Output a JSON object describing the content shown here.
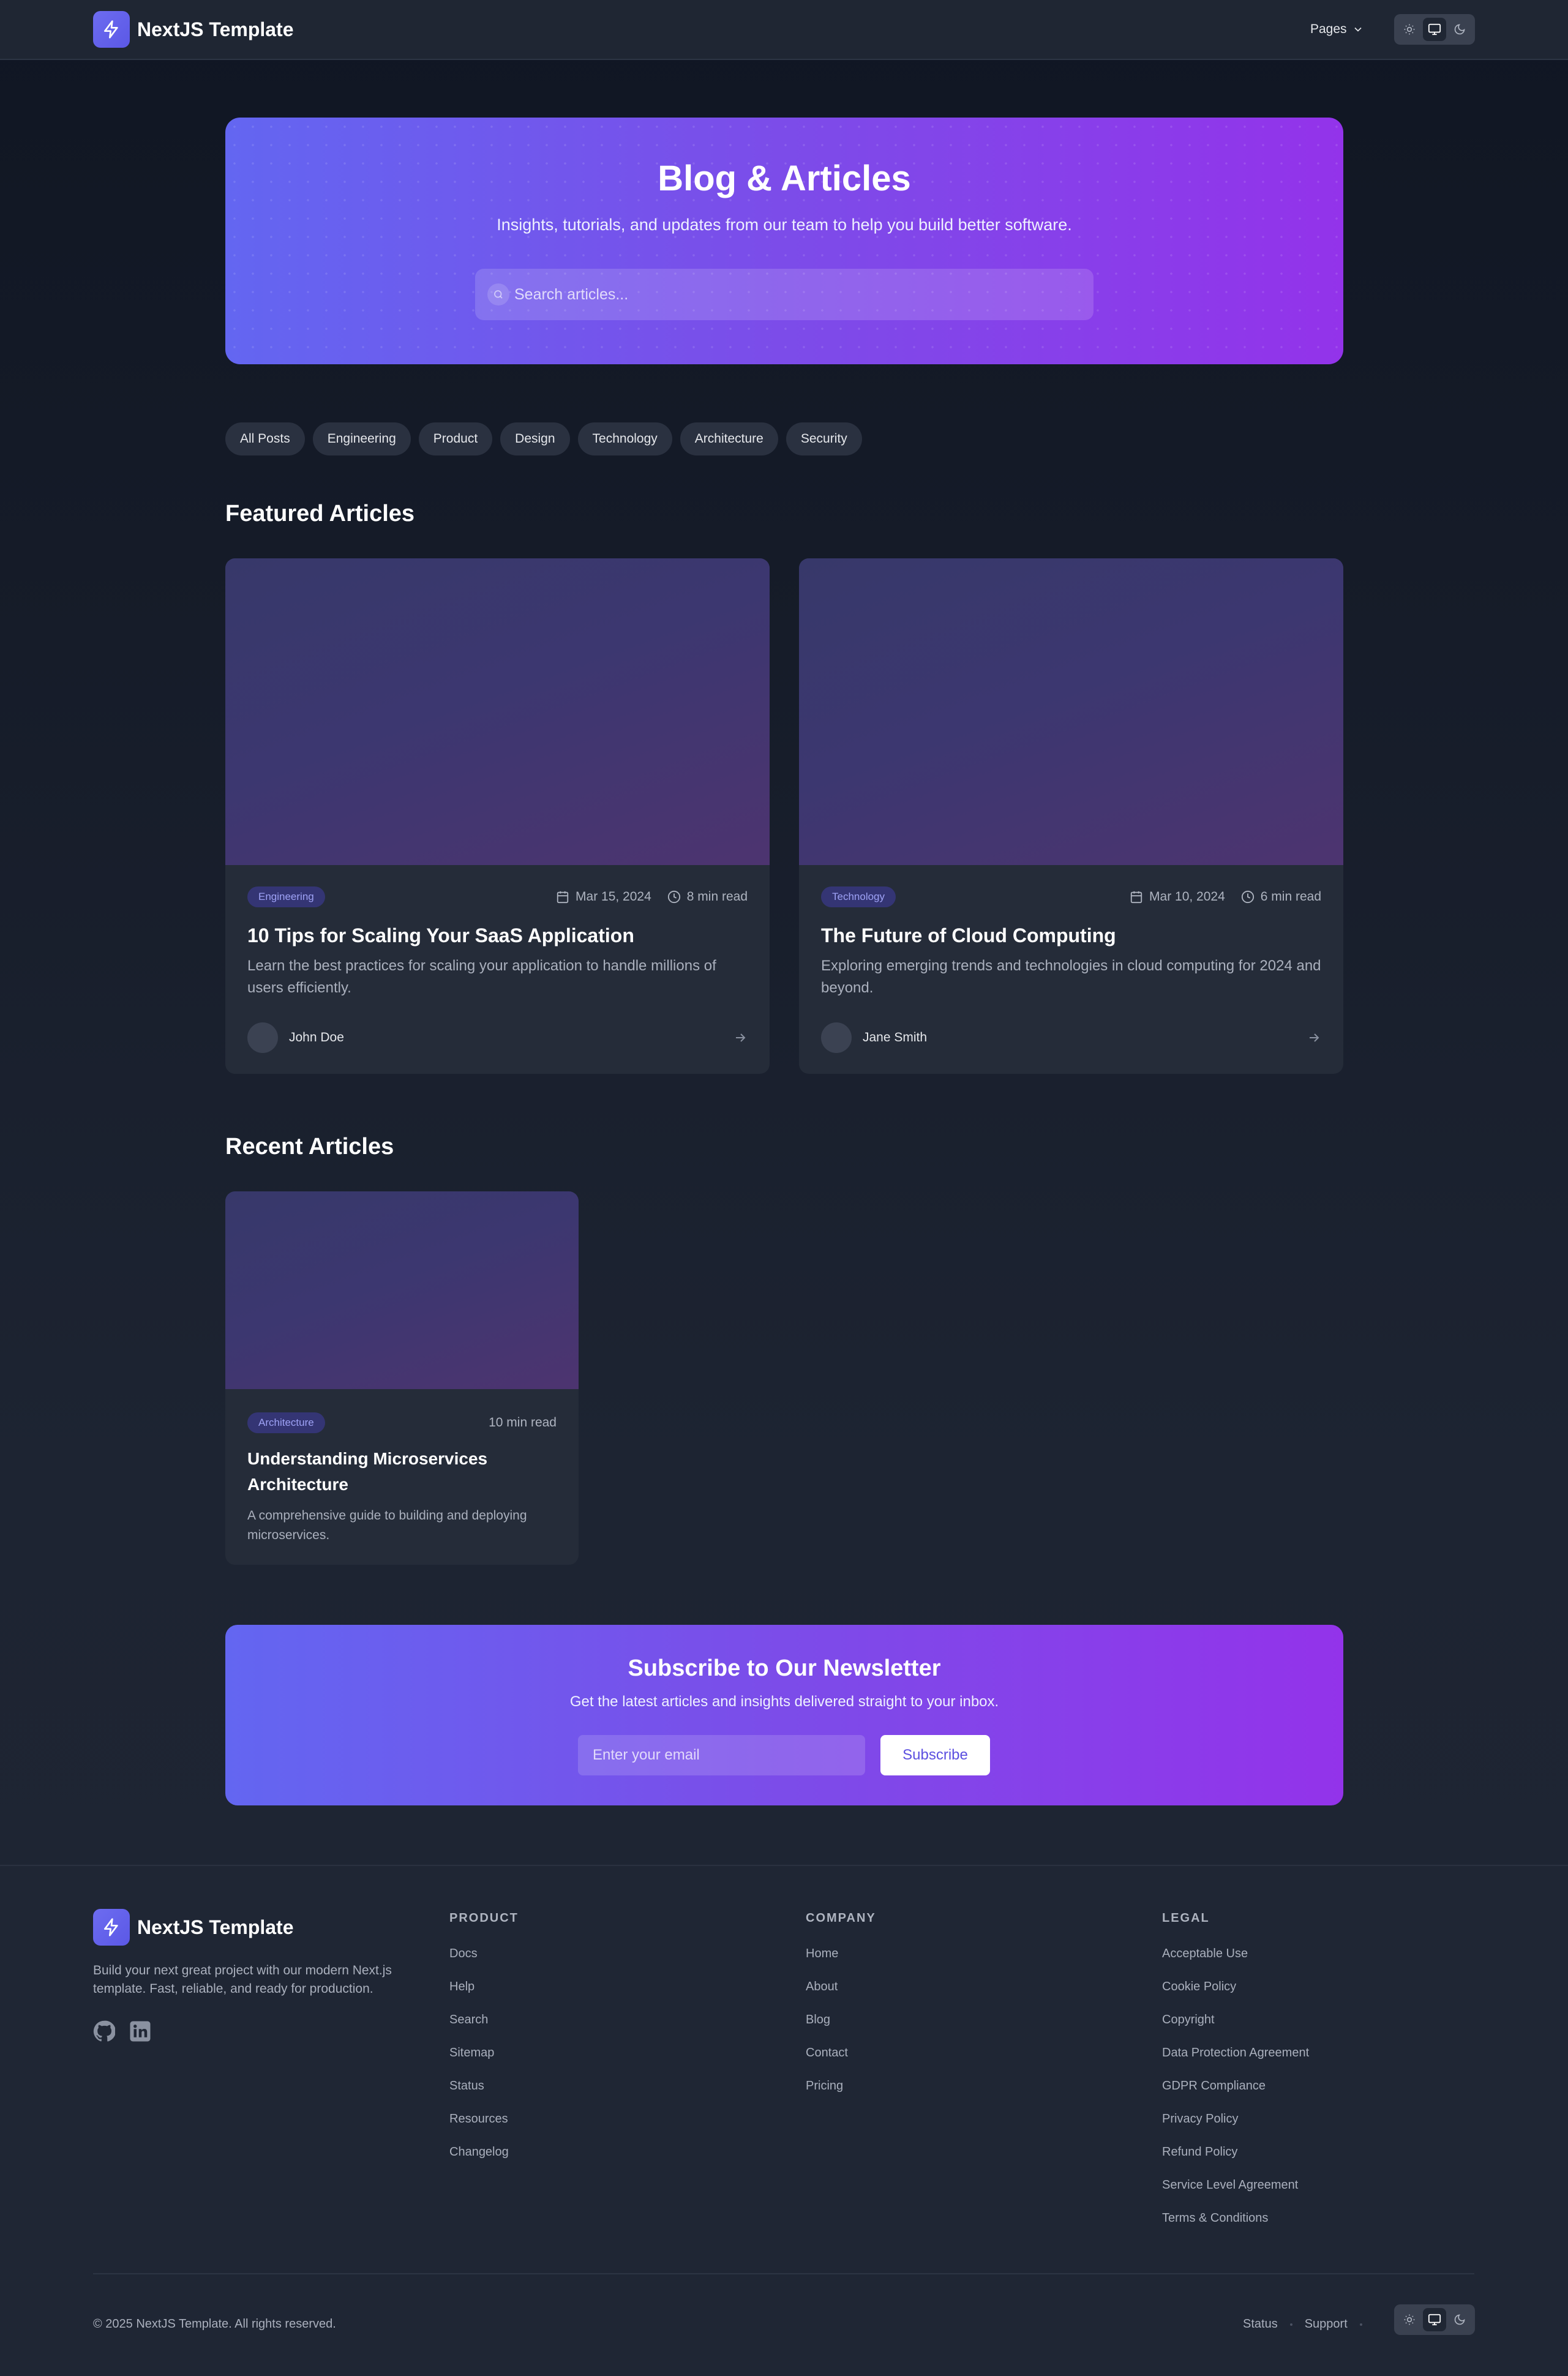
{
  "navbar": {
    "brand": "NextJS Template",
    "pages_label": "Pages",
    "theme_options": [
      "light",
      "system",
      "dark"
    ],
    "theme_active": "system"
  },
  "hero": {
    "title": "Blog & Articles",
    "subtitle": "Insights, tutorials, and updates from our team to help you build better software.",
    "search_placeholder": "Search articles..."
  },
  "categories": [
    "All Posts",
    "Engineering",
    "Product",
    "Design",
    "Technology",
    "Architecture",
    "Security"
  ],
  "featured": {
    "heading": "Featured Articles",
    "articles": [
      {
        "category": "Engineering",
        "date": "Mar 15, 2024",
        "read_time": "8 min read",
        "title": "10 Tips for Scaling Your SaaS Application",
        "description": "Learn the best practices for scaling your application to handle millions of users efficiently.",
        "author": "John Doe"
      },
      {
        "category": "Technology",
        "date": "Mar 10, 2024",
        "read_time": "6 min read",
        "title": "The Future of Cloud Computing",
        "description": "Exploring emerging trends and technologies in cloud computing for 2024 and beyond.",
        "author": "Jane Smith"
      }
    ]
  },
  "recent": {
    "heading": "Recent Articles",
    "articles": [
      {
        "category": "Architecture",
        "read_time": "10 min read",
        "title": "Understanding Microservices Architecture",
        "description": "A comprehensive guide to building and deploying microservices."
      }
    ]
  },
  "newsletter": {
    "title": "Subscribe to Our Newsletter",
    "subtitle": "Get the latest articles and insights delivered straight to your inbox.",
    "email_placeholder": "Enter your email",
    "button_label": "Subscribe"
  },
  "footer": {
    "brand": "NextJS Template",
    "description": "Build your next great project with our modern Next.js template. Fast, reliable, and ready for production.",
    "social": [
      "github-icon",
      "linkedin-icon"
    ],
    "columns": [
      {
        "title": "PRODUCT",
        "links": [
          "Docs",
          "Help",
          "Search",
          "Sitemap",
          "Status",
          "Resources",
          "Changelog"
        ]
      },
      {
        "title": "COMPANY",
        "links": [
          "Home",
          "About",
          "Blog",
          "Contact",
          "Pricing"
        ]
      },
      {
        "title": "LEGAL",
        "links": [
          "Acceptable Use",
          "Cookie Policy",
          "Copyright",
          "Data Protection Agreement",
          "GDPR Compliance",
          "Privacy Policy",
          "Refund Policy",
          "Service Level Agreement",
          "Terms & Conditions"
        ]
      }
    ],
    "copyright": "© 2025 NextJS Template. All rights reserved.",
    "bottom_links": [
      "Status",
      "Support"
    ]
  },
  "colors": {
    "accent_start": "#6366f1",
    "accent_end": "#9333ea",
    "page_bg": "#151b28",
    "card_bg": "#252c39"
  }
}
